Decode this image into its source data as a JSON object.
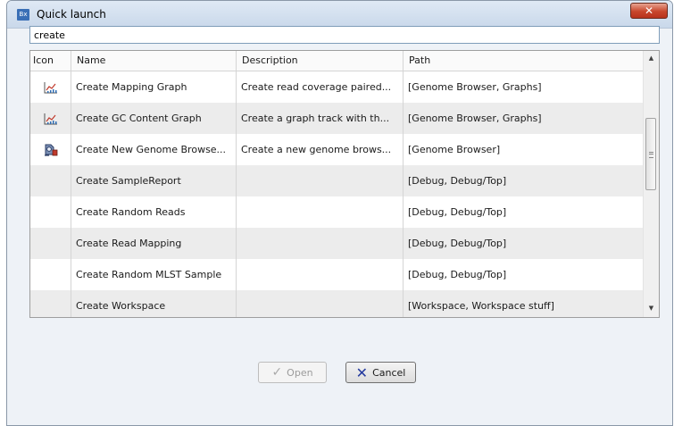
{
  "window": {
    "title": "Quick launch",
    "app_icon_text": "Bx",
    "close_glyph": "✕"
  },
  "search": {
    "value": "create"
  },
  "table": {
    "headers": [
      "Icon",
      "Name",
      "Description",
      "Path"
    ],
    "rows": [
      {
        "icon": "graph-icon",
        "name": "Create Mapping Graph",
        "description": "Create read coverage paired...",
        "path": "[Genome Browser, Graphs]"
      },
      {
        "icon": "graph-icon",
        "name": "Create GC Content Graph",
        "description": "Create a graph track with th...",
        "path": "[Genome Browser, Graphs]"
      },
      {
        "icon": "genome-browser-icon",
        "name": "Create New Genome Browse...",
        "description": "Create a new genome brows...",
        "path": "[Genome Browser]"
      },
      {
        "icon": "",
        "name": "Create SampleReport",
        "description": "",
        "path": "[Debug, Debug/Top]"
      },
      {
        "icon": "",
        "name": "Create Random Reads",
        "description": "",
        "path": "[Debug, Debug/Top]"
      },
      {
        "icon": "",
        "name": "Create Read Mapping",
        "description": "",
        "path": "[Debug, Debug/Top]"
      },
      {
        "icon": "",
        "name": "Create Random MLST Sample",
        "description": "",
        "path": "[Debug, Debug/Top]"
      },
      {
        "icon": "",
        "name": "Create Workspace",
        "description": "",
        "path": "[Workspace, Workspace stuff]"
      }
    ]
  },
  "buttons": {
    "open_label": "Open",
    "cancel_label": "Cancel"
  }
}
